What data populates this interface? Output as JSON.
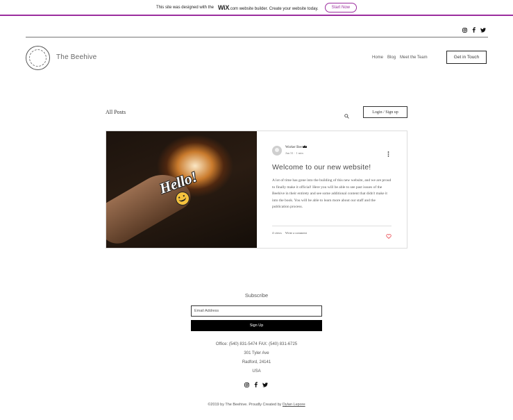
{
  "wix_banner": {
    "text_before": "This site was designed with the",
    "brand": "WiX",
    "text_after": ".com website builder. Create your website today.",
    "cta": "Start Now"
  },
  "header": {
    "site_name": "The Beehive",
    "nav": [
      "Home",
      "Blog",
      "Meet the Team"
    ],
    "cta": "Get in Touch",
    "social_icons": [
      "instagram-icon",
      "facebook-icon",
      "twitter-icon"
    ]
  },
  "blog": {
    "title": "All Posts",
    "login": "Login / Sign up",
    "post": {
      "author": "Worker Bee",
      "date": "Jan 31",
      "separator": "·",
      "read_time": "1 min",
      "title": "Welcome to our new website!",
      "excerpt": "A lot of time has gone into the building of this new website, and we are proud to finally make it official! Here you will be able to see past issues of the Beehive in their entirety and see some additional content that didn't make it into the book. You will be able to learn more about our staff and the publication process.",
      "views": "4 views",
      "comment": "Write a comment",
      "sticker_text": "Hello!"
    }
  },
  "footer": {
    "subscribe_title": "Subscribe",
    "email_placeholder": "Email Address",
    "signup": "Sign Up",
    "contact": [
      "Office: (540) 831-5474  FAX: (540) 831-6725",
      "301 Tyler Ave",
      "Radford, 24141",
      "USA"
    ],
    "copyright_prefix": "©2019 by The Beehive. Proudly Created by ",
    "copyright_author": "Dylan Lepore"
  },
  "colors": {
    "wix_accent": "#9b2c9e",
    "like_heart": "#e8474f"
  }
}
